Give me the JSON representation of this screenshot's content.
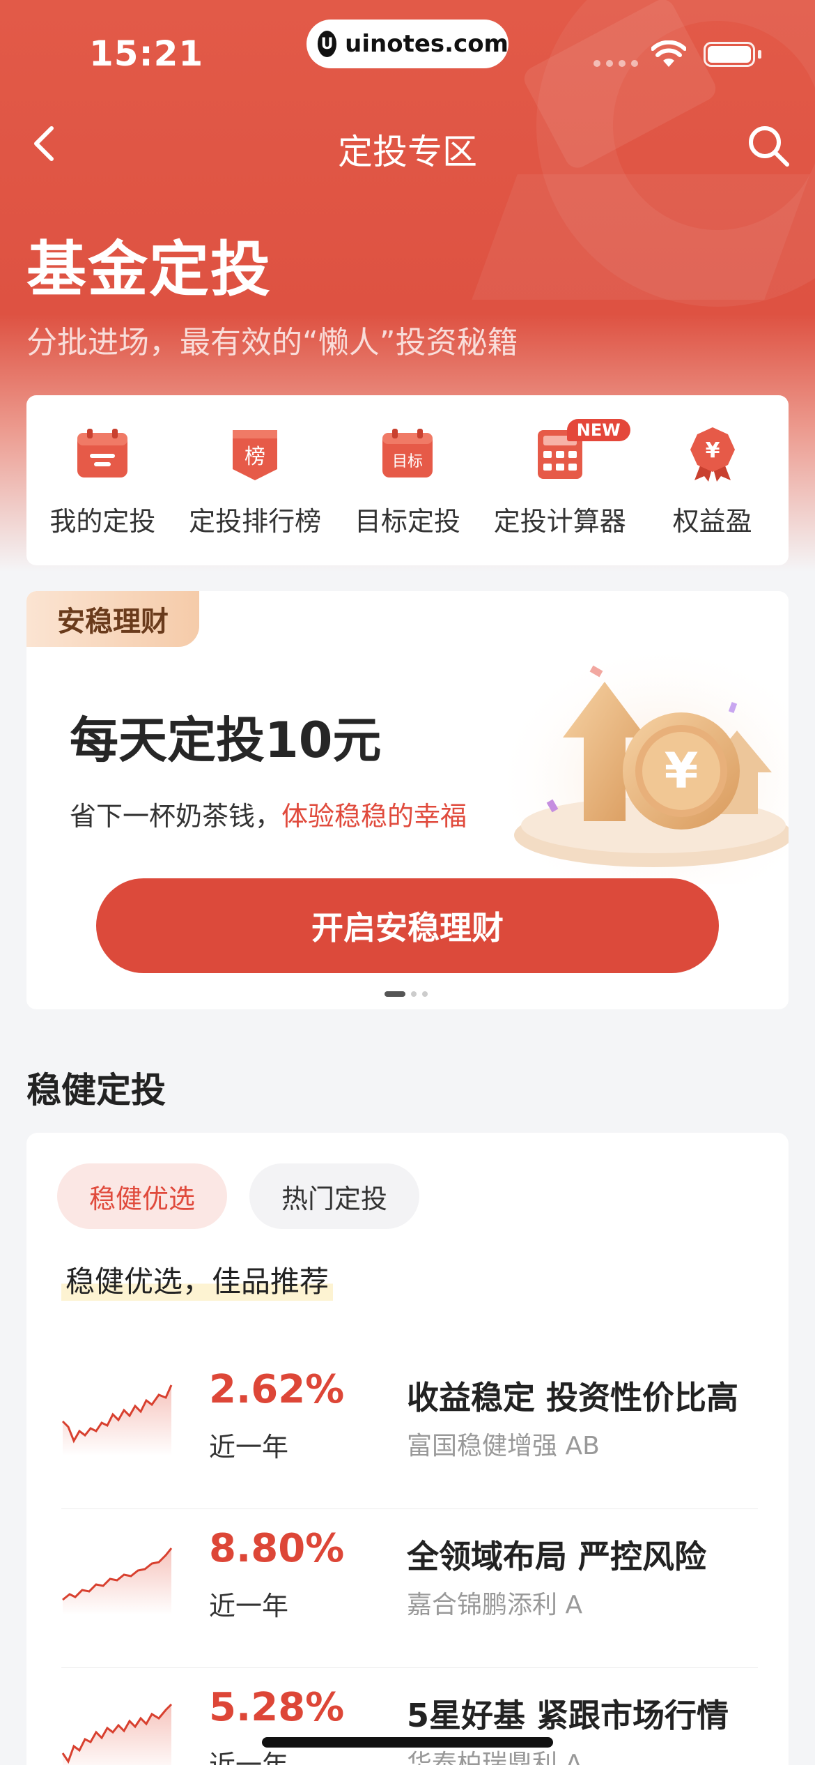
{
  "status_bar": {
    "time": "15:21",
    "domain": "uinotes.com"
  },
  "nav": {
    "title": "定投专区"
  },
  "hero": {
    "title": "基金定投",
    "subtitle": "分批进场，最有效的“懒人”投资秘籍"
  },
  "quick_links": [
    {
      "label": "我的定投",
      "icon": "calendar-icon"
    },
    {
      "label": "定投排行榜",
      "icon": "ranking-icon",
      "icon_text": "榜"
    },
    {
      "label": "目标定投",
      "icon": "target-calendar-icon",
      "icon_text": "目标"
    },
    {
      "label": "定投计算器",
      "icon": "calculator-icon",
      "badge": "NEW"
    },
    {
      "label": "权益盈",
      "icon": "yen-badge-icon",
      "icon_text": "¥"
    }
  ],
  "banner": {
    "tag": "安稳理财",
    "title": "每天定投10元",
    "subtitle_plain": "省下一杯奶茶钱，",
    "subtitle_highlight": "体验稳稳的幸福",
    "button": "开启安稳理财",
    "page_index": 1,
    "page_count": 3
  },
  "section": {
    "title": "稳健定投",
    "tabs": [
      {
        "label": "稳健优选",
        "active": true
      },
      {
        "label": "热门定投",
        "active": false
      }
    ],
    "description": "稳健优选，佳品推荐",
    "funds": [
      {
        "return": "2.62%",
        "period": "近一年",
        "headline": "收益稳定 投资性价比高",
        "name": "富国稳健增强 AB"
      },
      {
        "return": "8.80%",
        "period": "近一年",
        "headline": "全领域布局 严控风险",
        "name": "嘉合锦鹏添利 A"
      },
      {
        "return": "5.28%",
        "period": "近一年",
        "headline": "5星好基 紧跟市场行情",
        "name": "华泰柏瑞鼎利 A"
      }
    ]
  },
  "colors": {
    "brand_red": "#de5242",
    "accent_red": "#dd4637",
    "button_red": "#dc4a3b"
  }
}
